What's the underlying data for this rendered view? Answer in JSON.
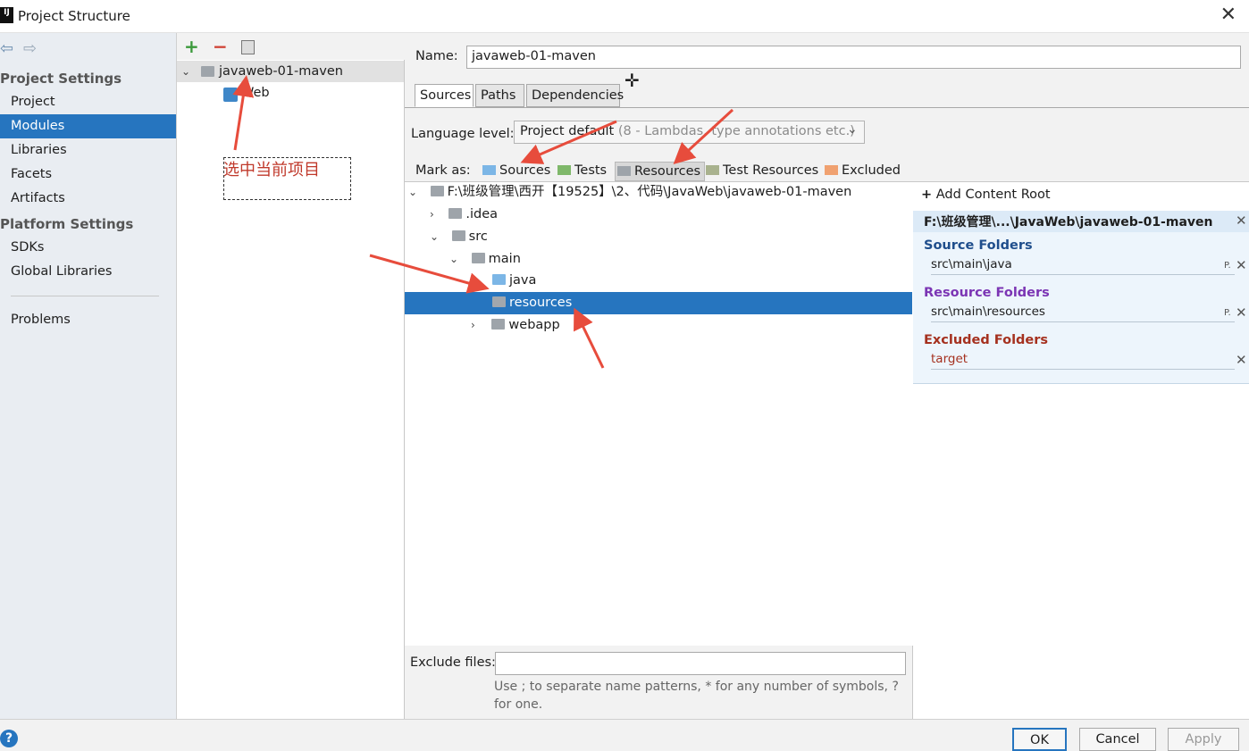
{
  "window": {
    "title": "Project Structure",
    "app_icon": "IJ"
  },
  "nav": {
    "project_settings": "Project Settings",
    "items_a": [
      "Project",
      "Modules",
      "Libraries",
      "Facets",
      "Artifacts"
    ],
    "platform_settings": "Platform Settings",
    "items_b": [
      "SDKs",
      "Global Libraries"
    ],
    "problems": "Problems"
  },
  "modules": {
    "root": "javaweb-01-maven",
    "child": "Web",
    "annotation": "选中当前项目"
  },
  "detail": {
    "name_label": "Name:",
    "name_value": "javaweb-01-maven",
    "tabs": [
      "Sources",
      "Paths",
      "Dependencies"
    ],
    "language_label": "Language level:",
    "language_value": "Project default",
    "language_hint": "(8 - Lambdas, type annotations etc.)",
    "mark_as_label": "Mark as:",
    "marks": [
      "Sources",
      "Tests",
      "Resources",
      "Test Resources",
      "Excluded"
    ],
    "tree": {
      "root": "F:\\班级管理\\西开【19525】\\2、代码\\JavaWeb\\javaweb-01-maven",
      "idea": ".idea",
      "src": "src",
      "main": "main",
      "java": "java",
      "resources": "resources",
      "webapp": "webapp"
    },
    "exclude_label": "Exclude files:",
    "exclude_hint": "Use ; to separate name patterns, * for any number of symbols, ? for one."
  },
  "content_root": {
    "add": "Add Content Root",
    "path": "F:\\班级管理\\...\\JavaWeb\\javaweb-01-maven",
    "source_title": "Source Folders",
    "source_item": "src\\main\\java",
    "resource_title": "Resource Folders",
    "resource_item": "src\\main\\resources",
    "excluded_title": "Excluded Folders",
    "excluded_item": "target"
  },
  "buttons": {
    "ok": "OK",
    "cancel": "Cancel",
    "apply": "Apply",
    "help": "?"
  },
  "colors": {
    "selection": "#2675bf",
    "source": "#1f4e8c",
    "resource": "#7b35b4",
    "excluded": "#a5311f",
    "annotation": "#e74c3c"
  }
}
